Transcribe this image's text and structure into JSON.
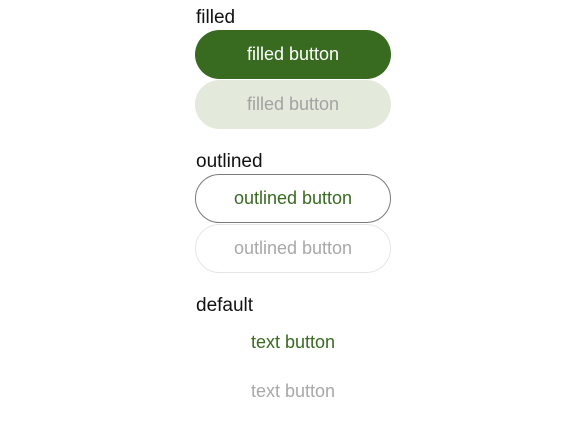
{
  "sections": {
    "filled": {
      "label": "filled",
      "enabled_button": "filled button",
      "disabled_button": "filled button"
    },
    "outlined": {
      "label": "outlined",
      "enabled_button": "outlined button",
      "disabled_button": "outlined button"
    },
    "default": {
      "label": "default",
      "enabled_button": "text button",
      "disabled_button": "text button"
    }
  },
  "colors": {
    "primary": "#386a20",
    "filled_disabled_bg": "#e3eadb",
    "disabled_text": "#a8a8a8",
    "outline": "#7a7a7a",
    "outline_disabled": "#e6e6e6"
  }
}
